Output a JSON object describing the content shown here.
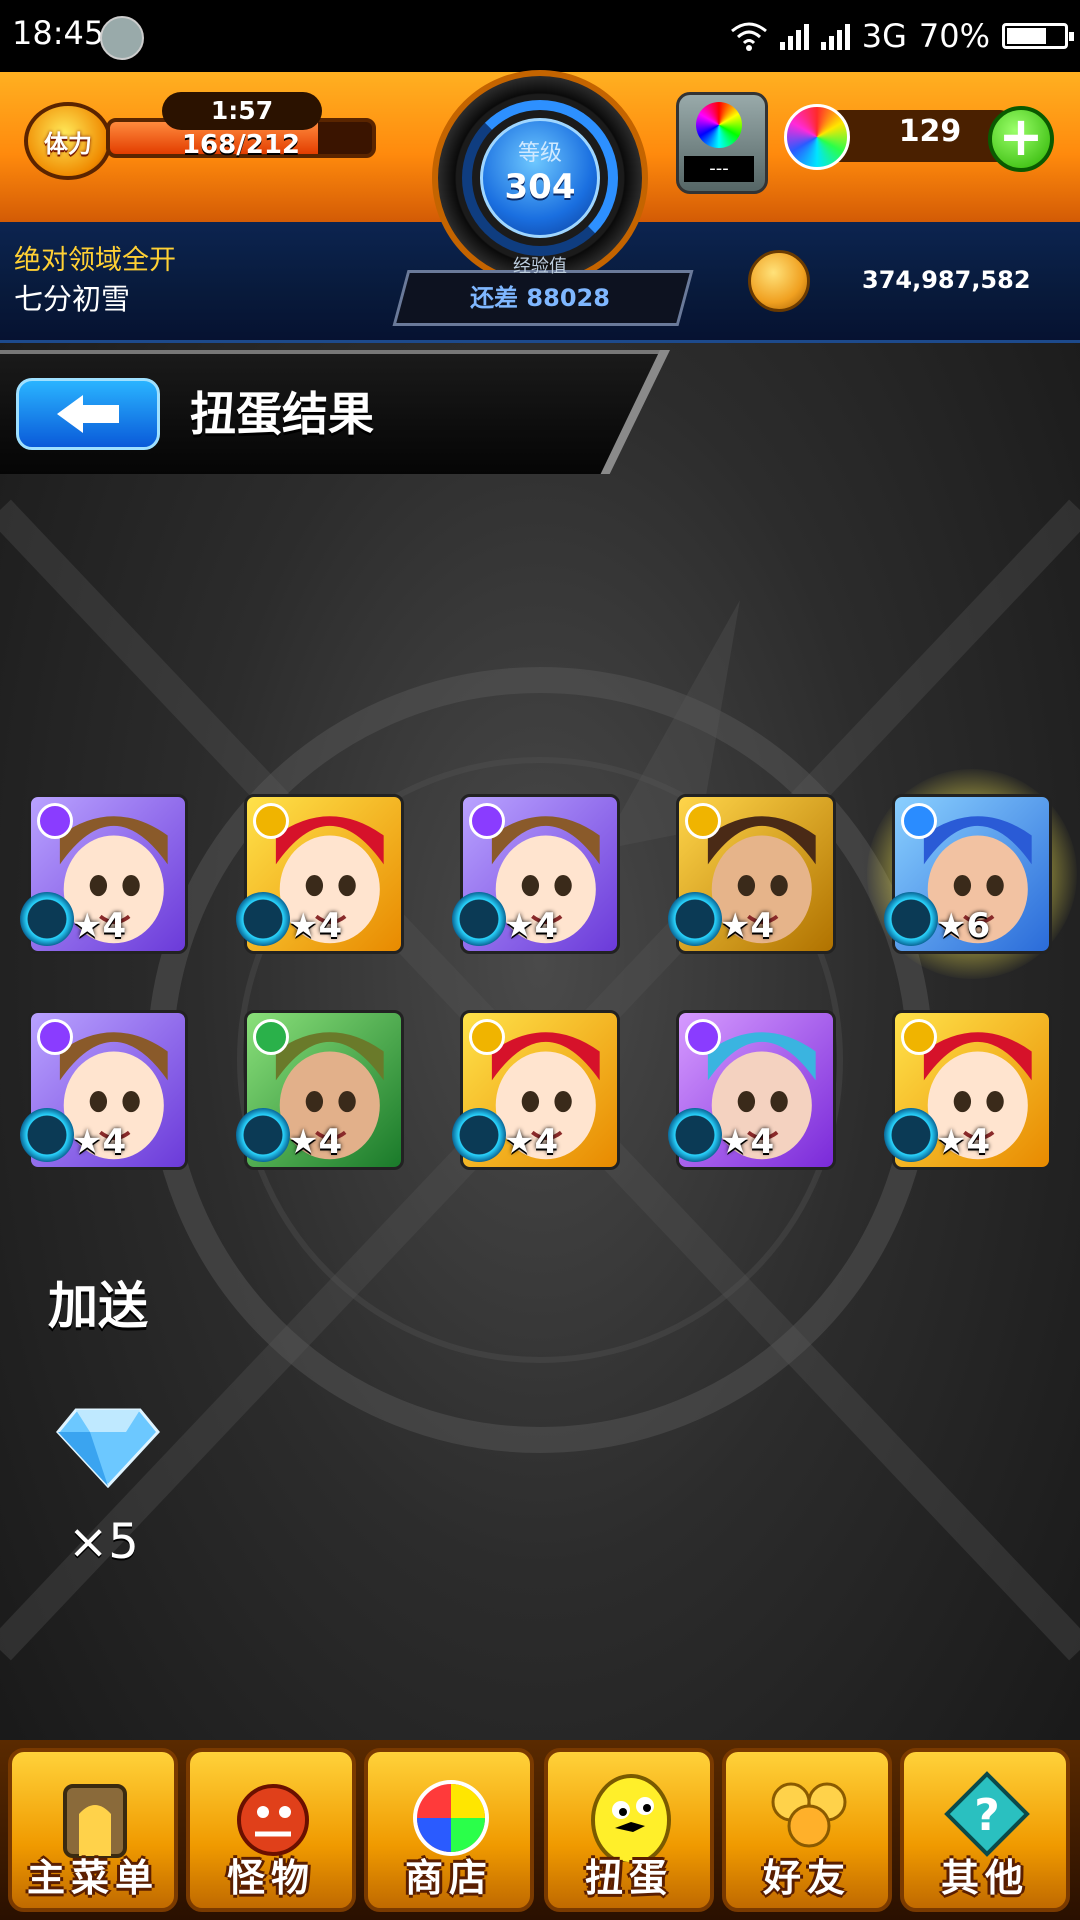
{
  "status_bar": {
    "time": "18:45",
    "network": "3G",
    "battery": "70%",
    "battery_level": 0.7
  },
  "hud": {
    "stamina_label": "体力",
    "stamina_timer": "1:57",
    "stamina": "168/212",
    "stamina_current": 168,
    "stamina_max": 212,
    "level_label": "等级",
    "level": "304",
    "exp_label": "经验值",
    "exp_remaining": "还差 88028",
    "orb_slot_value": "---",
    "orb_count": "129",
    "plus_label": "+",
    "quest_title": "绝对领域全开",
    "player_name": "七分初雪",
    "coins": "374,987,582"
  },
  "page": {
    "title": "扭蛋结果"
  },
  "results": [
    {
      "stars": "★4",
      "element": "purple",
      "palette": "girl"
    },
    {
      "stars": "★4",
      "element": "gold",
      "palette": "redhair"
    },
    {
      "stars": "★4",
      "element": "purple",
      "palette": "girl"
    },
    {
      "stars": "★4",
      "element": "gold",
      "palette": "curly"
    },
    {
      "stars": "★6",
      "element": "blue",
      "palette": "bluehair",
      "highlight": true
    },
    {
      "stars": "★4",
      "element": "purple",
      "palette": "girl"
    },
    {
      "stars": "★4",
      "element": "green",
      "palette": "greenhair"
    },
    {
      "stars": "★4",
      "element": "gold",
      "palette": "redhair"
    },
    {
      "stars": "★4",
      "element": "purple",
      "palette": "masked"
    },
    {
      "stars": "★4",
      "element": "gold",
      "palette": "redhair"
    }
  ],
  "bonus": {
    "label": "加送",
    "gem_count": "×5"
  },
  "bottom_nav": [
    {
      "label": "主菜单",
      "icon": "gate-icon"
    },
    {
      "label": "怪物",
      "icon": "monster-icon"
    },
    {
      "label": "商店",
      "icon": "orb-icon"
    },
    {
      "label": "扭蛋",
      "icon": "egg-icon"
    },
    {
      "label": "好友",
      "icon": "friends-icon"
    },
    {
      "label": "其他",
      "icon": "question-icon"
    }
  ],
  "colors": {
    "element_purple": "#8a3cff",
    "element_gold": "#f0b400",
    "element_blue": "#2a8cff",
    "element_green": "#2ab14a"
  }
}
